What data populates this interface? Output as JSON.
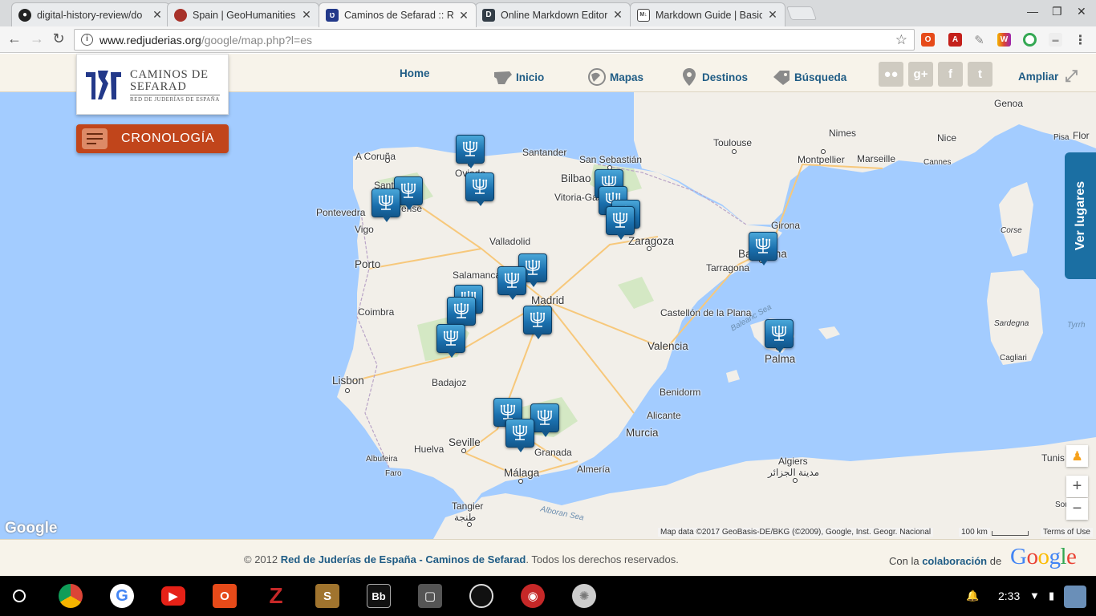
{
  "browser": {
    "tabs": [
      {
        "title": "digital-history-review/do",
        "icon": "github-icon",
        "active": false
      },
      {
        "title": "Spain | GeoHumanities",
        "icon": "geohumanities-icon",
        "active": false
      },
      {
        "title": "Caminos de Sefarad :: Re",
        "icon": "sefarad-icon",
        "active": true
      },
      {
        "title": "Online Markdown Editor",
        "icon": "dillinger-icon",
        "active": false
      },
      {
        "title": "Markdown Guide | Basic",
        "icon": "markdown-icon",
        "active": false
      }
    ],
    "url_host": "www.redjuderias.org",
    "url_path": "/google/map.php?l=es"
  },
  "site": {
    "logo": {
      "line1": "CAMINOS DE",
      "line2": "SEFARAD",
      "line3": "RED DE JUDERÍAS DE ESPAÑA"
    },
    "nav": [
      {
        "label": "Home",
        "icon": ""
      },
      {
        "label": "Inicio",
        "icon": "spain-map-icon"
      },
      {
        "label": "Mapas",
        "icon": "globe-icon"
      },
      {
        "label": "Destinos",
        "icon": "location-pin-icon"
      },
      {
        "label": "Búsqueda",
        "icon": "tag-icon"
      }
    ],
    "social": [
      "flickr-icon",
      "google-plus-icon",
      "facebook-icon",
      "twitter-icon"
    ],
    "ampliar": "Ampliar",
    "cronologia": "CRONOLOGÍA",
    "ver_lugares": "Ver lugares"
  },
  "map": {
    "cities": [
      "A Coruña",
      "Santander",
      "San Sebastián",
      "Bilbao",
      "Vitoria-Gasteiz",
      "Oviedo",
      "Pontevedra",
      "Vigo",
      "Ourense",
      "Santiago",
      "Valladolid",
      "Zaragoza",
      "Girona",
      "Barcelona",
      "Tarragona",
      "Porto",
      "Salamanca",
      "Madrid",
      "Coimbra",
      "Castellón de la Plana",
      "Valencia",
      "Palma",
      "Lisbon",
      "Badajoz",
      "Benidorm",
      "Alicante",
      "Murcia",
      "Huelva",
      "Seville",
      "Granada",
      "Albufeira",
      "Faro",
      "Málaga",
      "Almería",
      "Tangier",
      "طنجة",
      "Algiers",
      "مدينة الجزائر",
      "Toulouse",
      "Nimes",
      "Montpellier",
      "Marseille",
      "Nice",
      "Cannes",
      "Genoa",
      "Pisa",
      "Flor",
      "Corse",
      "Sardegna",
      "Cagliari",
      "Tunis",
      "Sou",
      "Tyrrh",
      "Balearic Sea",
      "Alboran Sea"
    ],
    "marker_count": 19,
    "google_logo": "Google",
    "attribution": "Map data ©2017 GeoBasis-DE/BKG (©2009), Google, Inst. Geogr. Nacional",
    "scale_label": "100 km",
    "terms": "Terms of Use",
    "zoom_in": "+",
    "zoom_out": "−"
  },
  "footer": {
    "copy_prefix": "© 2012 ",
    "copy_link": "Red de Juderías de España - Caminos de Sefarad",
    "copy_suffix": ". Todos los derechos reservados.",
    "colab_prefix": "Con la ",
    "colab_link": "colaboración",
    "colab_suffix": " de",
    "google": "Google"
  },
  "shelf": {
    "apps": [
      "chrome-icon",
      "google-icon",
      "youtube-icon",
      "office-icon",
      "zotero-icon",
      "scrivener-icon",
      "blackboard-icon",
      "crosh-icon",
      "github-icon",
      "owl-icon",
      "seal-icon"
    ],
    "time": "2:33"
  },
  "colors": {
    "accent": "#1f5c85",
    "cronologia": "#c1451b",
    "marker": "#1a6fad",
    "ocean": "#a3ccff"
  }
}
